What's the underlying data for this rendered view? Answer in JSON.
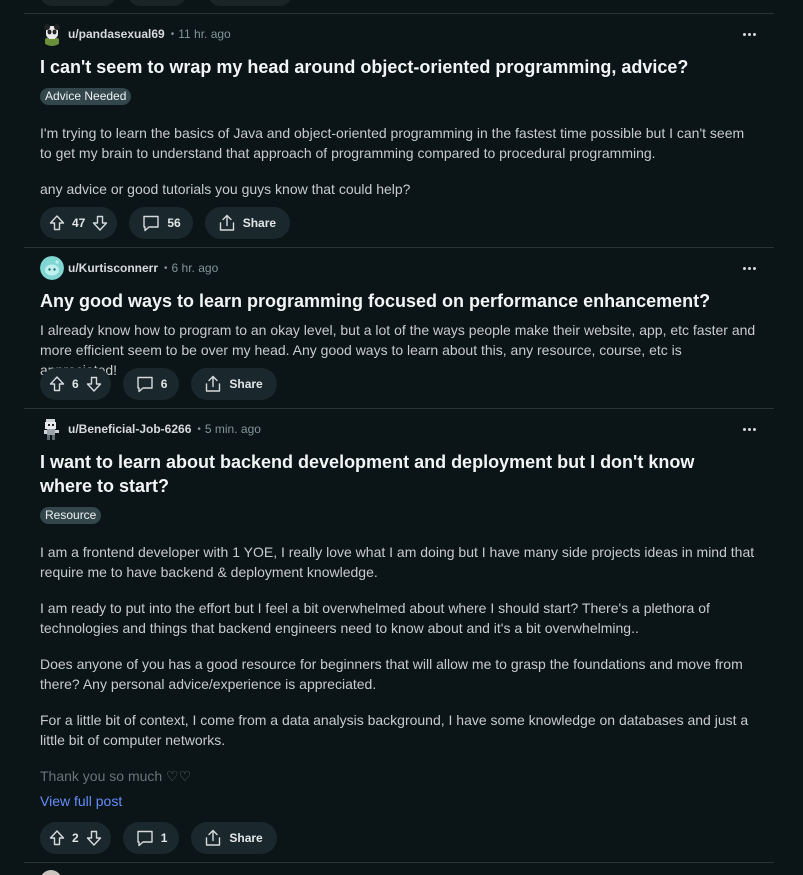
{
  "posts": [
    {
      "username": "u/pandasexual69",
      "separator": "•",
      "time": "11 hr. ago",
      "avatar_icon": "panda-avatar-icon",
      "title": "I can't seem to wrap my head around object-oriented programming, advice?",
      "flair": "Advice Needed",
      "body": [
        "I'm trying to learn the basics of Java and object-oriented programming in the fastest time possible but I can't seem to get my brain to understand that approach of programming compared to procedural programming.",
        "any advice or good tutorials you guys know that could help?"
      ],
      "votes": "47",
      "comments": "56",
      "share_label": "Share"
    },
    {
      "username": "u/Kurtisconnerr",
      "separator": "•",
      "time": "6 hr. ago",
      "avatar_icon": "snoo-avatar-icon",
      "title": "Any good ways to learn programming focused on performance enhancement?",
      "body": [
        "I already know how to program to an okay level, but a lot of the ways people make their website, app, etc faster and more efficient seem to be over my head. Any good ways to learn about this, any resource, course, etc is appreciated!"
      ],
      "votes": "6",
      "comments": "6",
      "share_label": "Share"
    },
    {
      "username": "u/Beneficial-Job-6266",
      "separator": "•",
      "time": "5 min. ago",
      "avatar_icon": "pixel-avatar-icon",
      "title": "I want to learn about backend development and deployment but I don't know where to start?",
      "flair": "Resource",
      "body": [
        "I am a frontend developer with 1 YOE, I really love what I am doing but I have many side projects ideas in mind that require me to have backend & deployment knowledge.",
        "I am ready to put into the effort but I feel a bit overwhelmed about where I should start? There's a plethora of technologies and things that backend engineers need to know about and it's a bit overwhelming..",
        "Does anyone of you has a good resource for beginners that will allow me to grasp the foundations and move from there? Any personal advice/experience is appreciated.",
        "For a little bit of context, I come from a data analysis background, I have some knowledge on databases and just a little bit of computer networks.",
        "Thank you so much ♡♡"
      ],
      "view_full": "View full post",
      "votes": "2",
      "comments": "1",
      "share_label": "Share"
    }
  ],
  "colors": {
    "background": "#0b1416",
    "button_bg": "#1a282d",
    "link": "#648efc",
    "divider": "#2a3236"
  }
}
